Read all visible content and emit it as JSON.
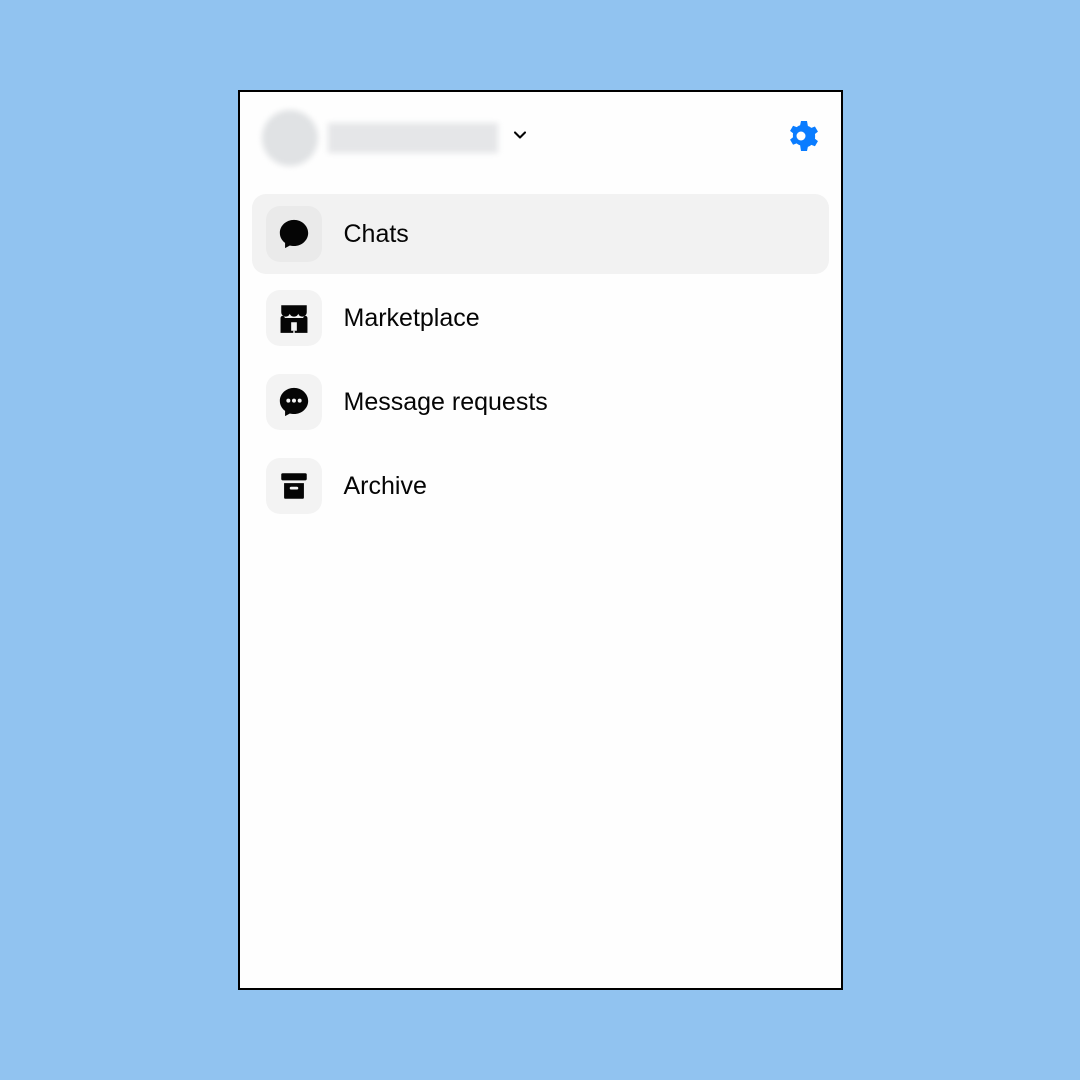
{
  "colors": {
    "accent": "#0a7cff"
  },
  "menu": {
    "items": [
      {
        "label": "Chats",
        "icon": "chat-icon",
        "active": true
      },
      {
        "label": "Marketplace",
        "icon": "marketplace-icon",
        "active": false
      },
      {
        "label": "Message requests",
        "icon": "message-requests-icon",
        "active": false
      },
      {
        "label": "Archive",
        "icon": "archive-icon",
        "active": false
      }
    ]
  }
}
